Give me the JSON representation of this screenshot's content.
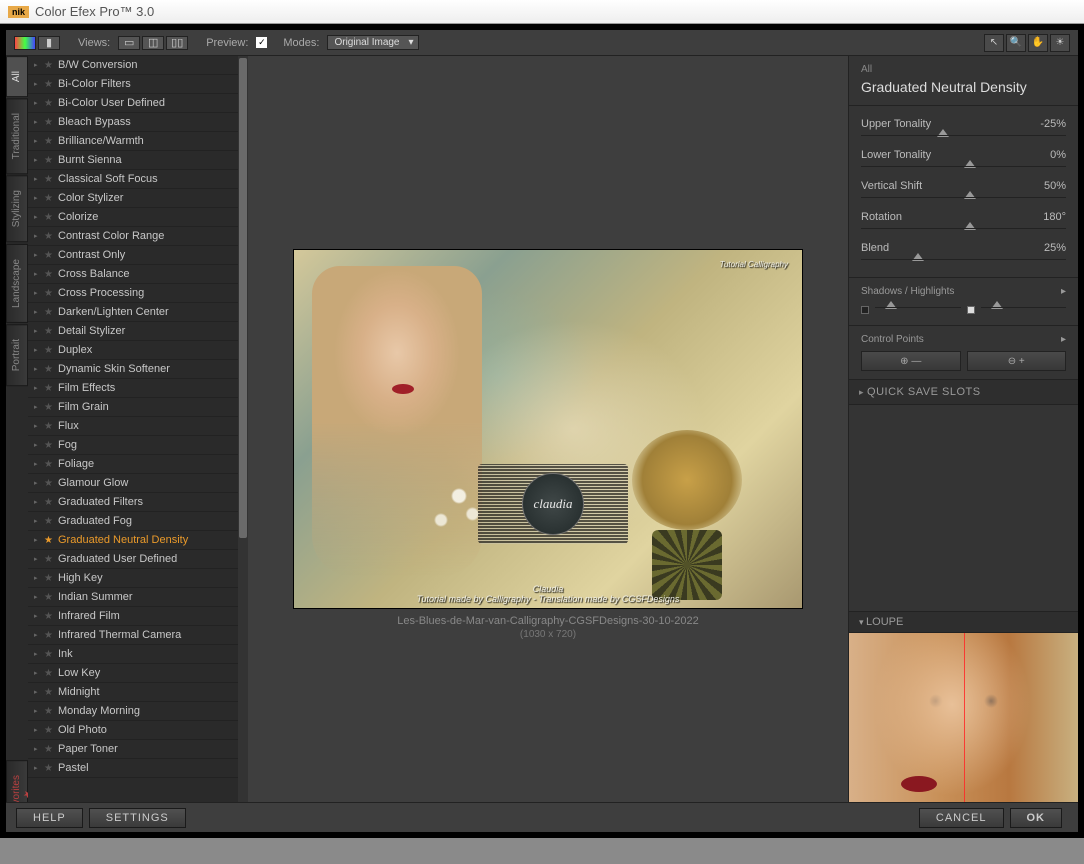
{
  "title": "Color Efex Pro™ 3.0",
  "brand": "nik",
  "toolbar": {
    "views_label": "Views:",
    "preview_label": "Preview:",
    "modes_label": "Modes:",
    "modes_value": "Original Image"
  },
  "vtabs": [
    "All",
    "Traditional",
    "Stylizing",
    "Landscape",
    "Portrait"
  ],
  "favorites_tab": "Favorites",
  "filters": [
    "B/W Conversion",
    "Bi-Color Filters",
    "Bi-Color User Defined",
    "Bleach Bypass",
    "Brilliance/Warmth",
    "Burnt Sienna",
    "Classical Soft Focus",
    "Color Stylizer",
    "Colorize",
    "Contrast Color Range",
    "Contrast Only",
    "Cross Balance",
    "Cross Processing",
    "Darken/Lighten Center",
    "Detail Stylizer",
    "Duplex",
    "Dynamic Skin Softener",
    "Film Effects",
    "Film Grain",
    "Flux",
    "Fog",
    "Foliage",
    "Glamour Glow",
    "Graduated Filters",
    "Graduated Fog",
    "Graduated Neutral Density",
    "Graduated User Defined",
    "High Key",
    "Indian Summer",
    "Infrared Film",
    "Infrared Thermal Camera",
    "Ink",
    "Low Key",
    "Midnight",
    "Monday Morning",
    "Old Photo",
    "Paper Toner",
    "Pastel"
  ],
  "selected_filter_index": 25,
  "preview": {
    "caption": "Les-Blues-de-Mar-van-Calligraphy-CGSFDesigns-30-10-2022",
    "dims": "(1030 x 720)",
    "overlay_credit": "Tutorial made by Calligraphy - Translation made by CGSFDesigns",
    "overlay_signature": "Claudia",
    "watermark": "Tutorial Calligraphy",
    "badge": "claudia"
  },
  "right": {
    "category": "All",
    "filter_name": "Graduated Neutral Density",
    "sliders": [
      {
        "label": "Upper Tonality",
        "value": "-25%",
        "pos": 37
      },
      {
        "label": "Lower Tonality",
        "value": "0%",
        "pos": 50
      },
      {
        "label": "Vertical Shift",
        "value": "50%",
        "pos": 50
      },
      {
        "label": "Rotation",
        "value": "180°",
        "pos": 50
      },
      {
        "label": "Blend",
        "value": "25%",
        "pos": 25
      }
    ],
    "shadows_label": "Shadows / Highlights",
    "control_points_label": "Control Points",
    "qss": "QUICK SAVE SLOTS",
    "loupe": "LOUPE"
  },
  "footer": {
    "help": "HELP",
    "settings": "SETTINGS",
    "cancel": "CANCEL",
    "ok": "OK"
  }
}
